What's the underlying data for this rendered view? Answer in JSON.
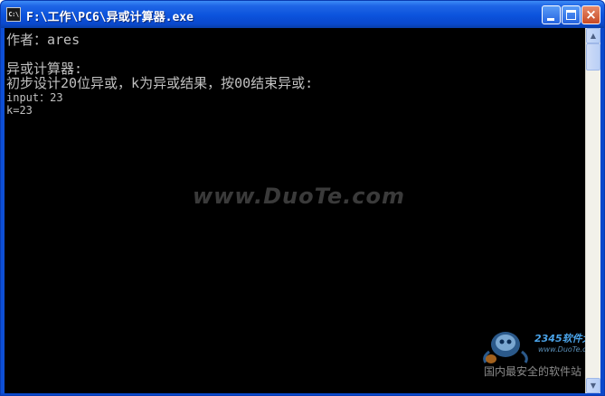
{
  "window": {
    "title": "F:\\工作\\PC6\\异或计算器.exe",
    "icon": "console-icon",
    "icon_label": "C:\\"
  },
  "controls": {
    "minimize": "minimize-icon",
    "maximize": "maximize-icon",
    "close": "×"
  },
  "console": {
    "lines": [
      "作者：ares",
      "",
      "异或计算器:",
      "初步设计20位异或，k为异或结果，按00结束异或:",
      "input：23",
      "k=23"
    ]
  },
  "overlay": {
    "watermark": "www.DuoTe.com",
    "logo_name": "2345软件大全",
    "logo_url": "www.DuoTe.com",
    "logo_caption": "国内最安全的软件站"
  },
  "scrollbar": {
    "up": "▲",
    "down": "▼"
  }
}
